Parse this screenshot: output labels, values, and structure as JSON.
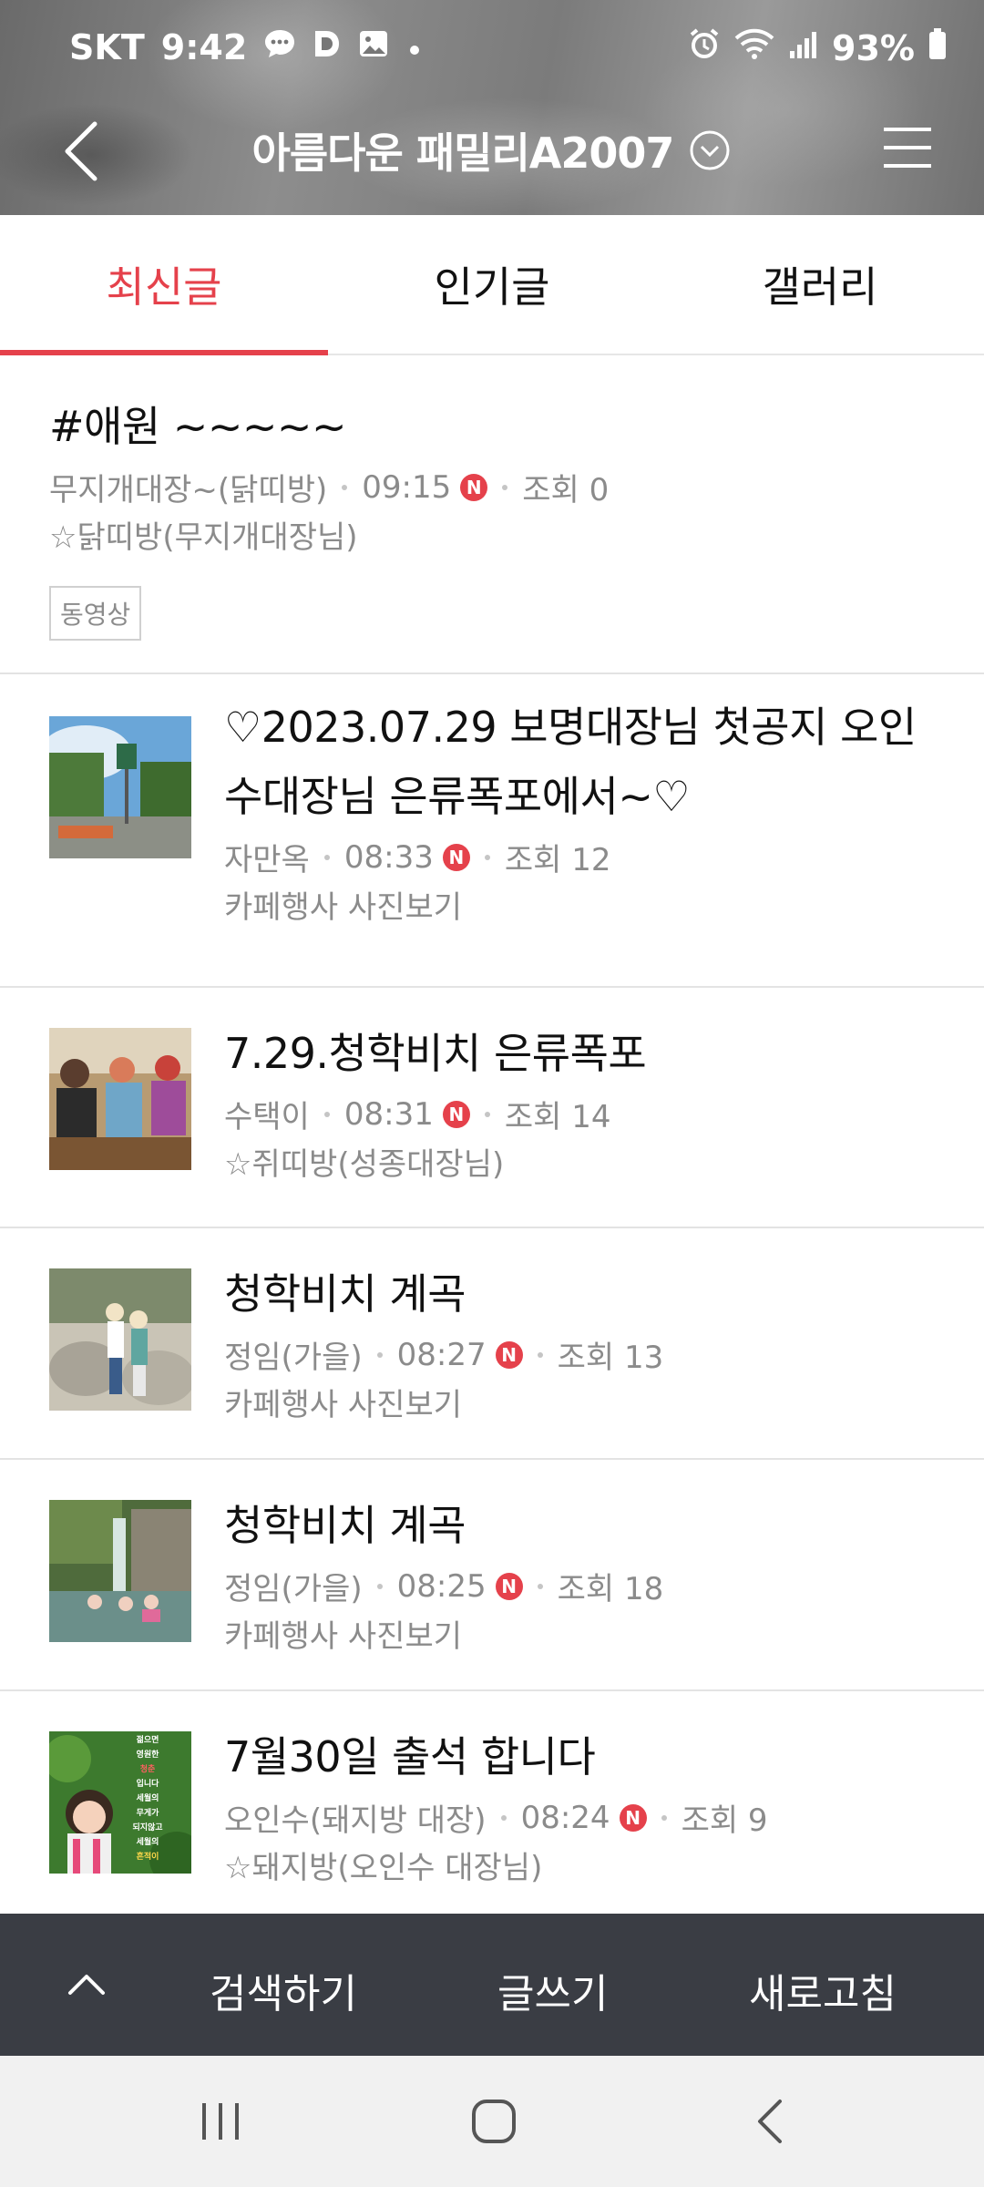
{
  "status_bar": {
    "carrier": "SKT",
    "time": "9:42",
    "battery": "93%",
    "left_icons": [
      "chat-bubble-icon",
      "d-app-icon",
      "gallery-icon",
      "dot-icon"
    ],
    "right_icons": [
      "alarm-icon",
      "wifi-icon",
      "signal-icon",
      "battery-icon"
    ]
  },
  "header": {
    "cafe_name": "아름다운 패밀리A2007",
    "back_icon": "back-arrow-icon",
    "dropdown_icon": "chevron-down-circle-icon",
    "menu_icon": "hamburger-menu-icon"
  },
  "tabs": [
    {
      "label": "최신글",
      "active": true
    },
    {
      "label": "인기글",
      "active": false
    },
    {
      "label": "갤러리",
      "active": false
    }
  ],
  "posts": [
    {
      "title": "#애원 ~~~~~",
      "author": "무지개대장~(닭띠방)",
      "time": "09:15",
      "new_badge": "N",
      "views": "조회 0",
      "board": "☆닭띠방(무지개대장님)",
      "tag": "동영상",
      "has_thumb": false
    },
    {
      "title_line1": "♡2023.07.29 보명대장님 첫공지 오인",
      "title_line2": "수대장님 은류폭포에서~♡",
      "author": "자만옥",
      "time": "08:33",
      "new_badge": "N",
      "views": "조회 12",
      "board": "카페행사 사진보기",
      "has_thumb": true
    },
    {
      "title": "7.29.청학비치 은류폭포",
      "author": "수택이",
      "time": "08:31",
      "new_badge": "N",
      "views": "조회 14",
      "board": "☆쥐띠방(성종대장님)",
      "has_thumb": true
    },
    {
      "title": "청학비치 계곡",
      "author": "정임(가을)",
      "time": "08:27",
      "new_badge": "N",
      "views": "조회 13",
      "board": "카페행사 사진보기",
      "has_thumb": true
    },
    {
      "title": "청학비치 계곡",
      "author": "정임(가을)",
      "time": "08:25",
      "new_badge": "N",
      "views": "조회 18",
      "board": "카페행사 사진보기",
      "has_thumb": true
    },
    {
      "title": "7월30일 출석 합니다",
      "author": "오인수(돼지방 대장)",
      "time": "08:24",
      "new_badge": "N",
      "views": "조회 9",
      "board": "☆돼지방(오인수 대장님)",
      "has_thumb": true,
      "thumb_text": [
        "젊으면",
        "영원한",
        "청춘",
        "입니다",
        "세월의",
        "무게가",
        "되지않고",
        "세월의",
        "흔적이"
      ]
    }
  ],
  "toolbar": {
    "scroll_top_icon": "chevron-up-icon",
    "search": "검색하기",
    "write": "글쓰기",
    "refresh": "새로고침"
  },
  "nav": {
    "recent_icon": "recent-apps-icon",
    "home_icon": "home-icon",
    "back_icon": "nav-back-icon"
  },
  "colors": {
    "accent": "#e5414b",
    "toolbar_bg": "#3a3d44",
    "meta_text": "#8b8b8b"
  }
}
